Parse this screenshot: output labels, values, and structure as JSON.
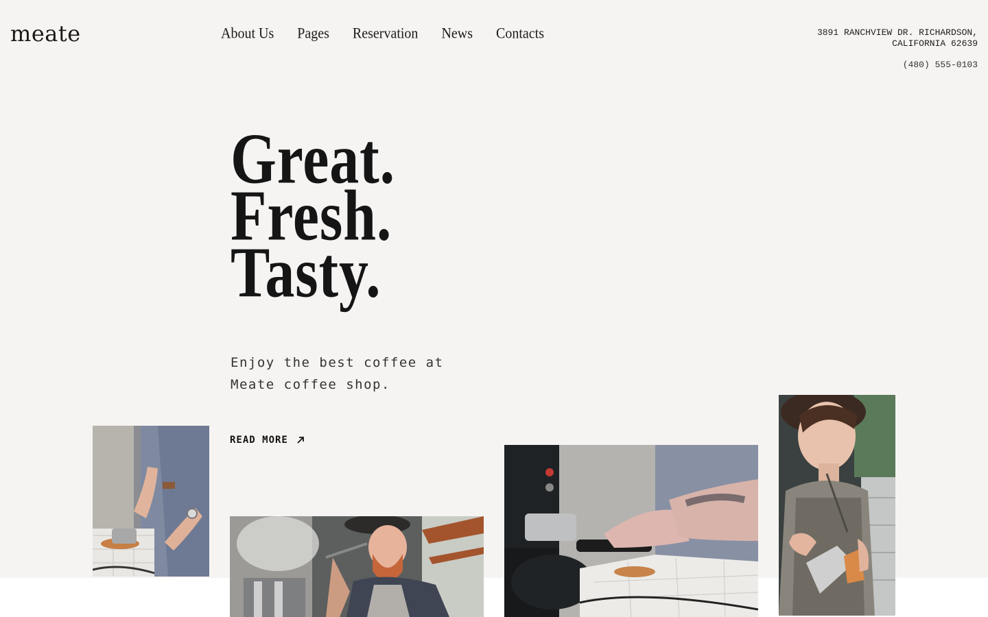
{
  "header": {
    "logo": "meate",
    "nav": [
      {
        "label": "About Us"
      },
      {
        "label": "Pages"
      },
      {
        "label": "Reservation"
      },
      {
        "label": "News"
      },
      {
        "label": "Contacts"
      }
    ],
    "address_line1": "3891 RANCHVIEW DR. RICHARDSON,",
    "address_line2": "CALIFORNIA 62639",
    "phone": "(480) 555-0103"
  },
  "hero": {
    "title_lines": [
      "Great.",
      "Fresh.",
      "Tasty."
    ],
    "subtitle": "Enjoy the best coffee at Meate coffee shop.",
    "cta_label": "READ MORE",
    "cta_icon": "arrow-up-right-icon"
  },
  "gallery": [
    {
      "name": "barista-tamping-photo"
    },
    {
      "name": "barista-steaming-milk-photo"
    },
    {
      "name": "coffee-grinder-photo"
    },
    {
      "name": "barista-pouring-latte-photo"
    }
  ],
  "colors": {
    "background": "#f6f4f2",
    "band": "#ffffff",
    "text": "#161616"
  }
}
